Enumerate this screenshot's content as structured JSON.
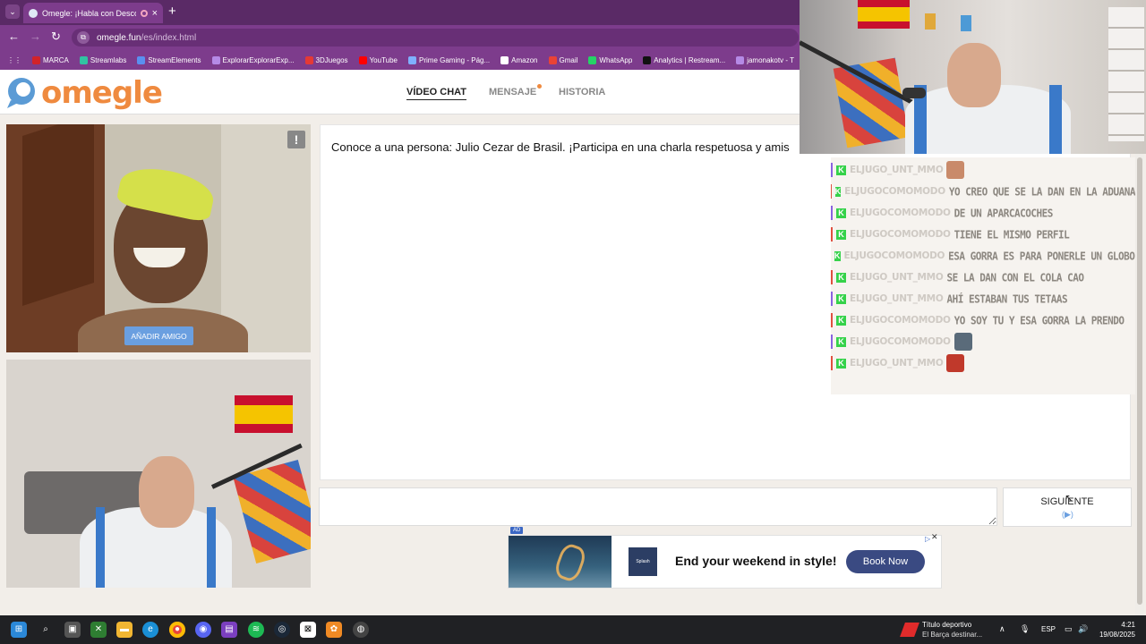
{
  "browser": {
    "tab_title": "Omegle: ¡Habla con Descon",
    "close_glyph": "×",
    "new_tab_glyph": "+",
    "url_host": "omegle.fun",
    "url_path": "/es/index.html",
    "bookmarks": [
      {
        "label": "MARCA",
        "color": "#d2232a"
      },
      {
        "label": "Streamlabs",
        "color": "#31c3a2"
      },
      {
        "label": "StreamElements",
        "color": "#5a8ff0"
      },
      {
        "label": "ExplorarExplorarExp...",
        "color": "#b58ae6"
      },
      {
        "label": "3DJuegos",
        "color": "#e53935"
      },
      {
        "label": "YouTube",
        "color": "#ff0000"
      },
      {
        "label": "Prime Gaming - Pág...",
        "color": "#7fb0ff"
      },
      {
        "label": "Amazon",
        "color": "#ffffff"
      },
      {
        "label": "Gmail",
        "color": "#ea4335"
      },
      {
        "label": "WhatsApp",
        "color": "#25d366"
      },
      {
        "label": "Analytics | Restream...",
        "color": "#111111"
      },
      {
        "label": "jamonakotv - T",
        "color": "#b58ae6"
      }
    ]
  },
  "omegle": {
    "logo_text": "omegle",
    "nav": {
      "video": "VÍDEO CHAT",
      "message": "MENSAJE",
      "history": "HISTORIA"
    },
    "report_glyph": "!",
    "add_friend_label": "AÑADIR AMIGO",
    "chat_intro": "Conoce a una persona: Julio Cezar de Brasil. ¡Participa en una charla respetuosa y amis",
    "next_label": "SIGUIENTE",
    "next_icon_glyph": "(▶)"
  },
  "ad": {
    "tag": "AD",
    "headline": "End your weekend in style!",
    "cta": "Book Now",
    "logo_text": "Splash",
    "close_glyph": "✕",
    "info_glyph": "▷"
  },
  "stream_chat": [
    {
      "user": "ELJUGO_UNT_MMO",
      "text": "",
      "emote": "#c98a6a",
      "bar": "#8a62e0"
    },
    {
      "user": "ELJUGOCOMOMODO",
      "text": "YO CREO QUE SE LA DAN EN LA ADUANA",
      "emote": "",
      "bar": "#e05040"
    },
    {
      "user": "ELJUGOCOMOMODO",
      "text": "DE UN APARCACOCHES",
      "emote": "",
      "bar": "#8a62e0"
    },
    {
      "user": "ELJUGOCOMOMODO",
      "text": "TIENE EL MISMO PERFIL",
      "emote": "",
      "bar": "#e05040"
    },
    {
      "user": "ELJUGOCOMOMODO",
      "text": "ESA GORRA ES PARA PONERLE UN GLOBO AEROSTÁTICO",
      "emote": "",
      "bar": "#8a62e0"
    },
    {
      "user": "ELJUGO_UNT_MMO",
      "text": "SE LA DAN CON EL COLA CAO",
      "emote": "",
      "bar": "#e05040"
    },
    {
      "user": "ELJUGO_UNT_MMO",
      "text": "AHÍ ESTABAN TUS TETAAS",
      "emote": "",
      "bar": "#8a62e0"
    },
    {
      "user": "ELJUGOCOMOMODO",
      "text": "YO SOY TU Y ESA GORRA LA PRENDO",
      "emote": "",
      "bar": "#e05040"
    },
    {
      "user": "ELJUGOCOMOMODO",
      "text": "",
      "emote": "#5a6b7a",
      "bar": "#8a62e0"
    },
    {
      "user": "ELJUGO_UNT_MMO",
      "text": "",
      "emote": "#c0392b",
      "bar": "#e05040"
    }
  ],
  "taskbar": {
    "news_title": "Título deportivo",
    "news_sub": "El Barça destinar...",
    "lang": "ESP",
    "time": "4:21",
    "date": "19/08/2025"
  }
}
